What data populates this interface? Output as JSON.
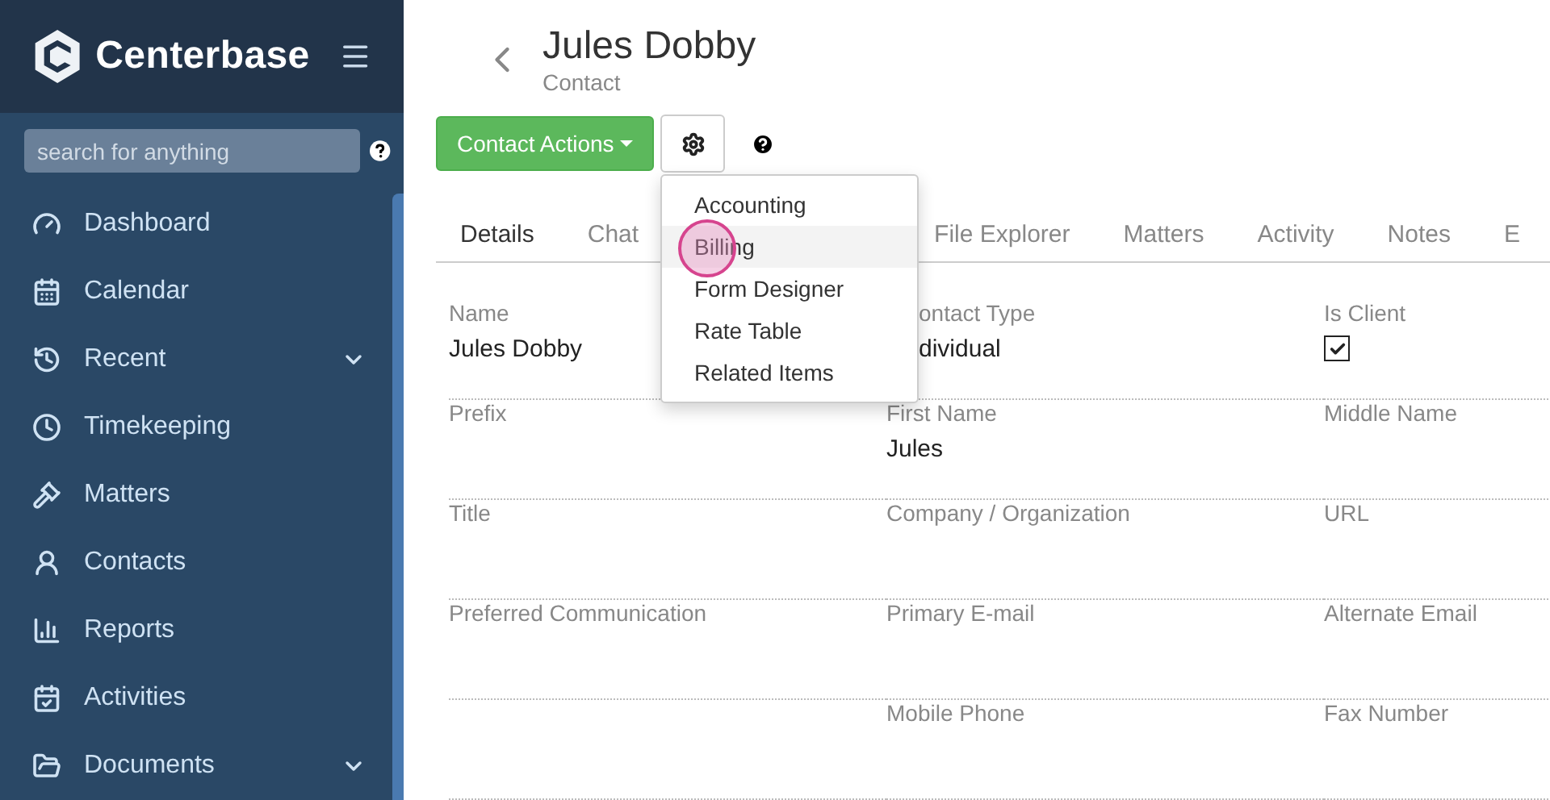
{
  "sidebar": {
    "brand": "Centerbase",
    "search": {
      "placeholder": "search for anything"
    },
    "items": [
      {
        "label": "Dashboard",
        "expandable": false
      },
      {
        "label": "Calendar",
        "expandable": false
      },
      {
        "label": "Recent",
        "expandable": true
      },
      {
        "label": "Timekeeping",
        "expandable": false
      },
      {
        "label": "Matters",
        "expandable": false
      },
      {
        "label": "Contacts",
        "expandable": false
      },
      {
        "label": "Reports",
        "expandable": false
      },
      {
        "label": "Activities",
        "expandable": false
      },
      {
        "label": "Documents",
        "expandable": true
      }
    ]
  },
  "header": {
    "title": "Jules Dobby",
    "subtitle": "Contact"
  },
  "toolbar": {
    "actions_button": "Contact Actions"
  },
  "tabs": [
    {
      "label": "Details",
      "selected": true
    },
    {
      "label": "Chat",
      "selected": false
    },
    {
      "label": "File Explorer",
      "selected": false
    },
    {
      "label": "Matters",
      "selected": false
    },
    {
      "label": "Activity",
      "selected": false
    },
    {
      "label": "Notes",
      "selected": false
    },
    {
      "label": "E",
      "selected": false
    }
  ],
  "fields": [
    {
      "kind": "text",
      "label": "Name",
      "value": "Jules Dobby"
    },
    {
      "kind": "covered",
      "label": "ontact Type",
      "value": "dividual"
    },
    {
      "kind": "checkbox",
      "label": "Is Client",
      "checked": true
    },
    {
      "kind": "text",
      "label": "Prefix"
    },
    {
      "kind": "text",
      "label": "First Name",
      "value": "Jules"
    },
    {
      "kind": "text",
      "label": "Middle Name"
    },
    {
      "kind": "text",
      "label": "Title"
    },
    {
      "kind": "text",
      "label": "Company / Organization"
    },
    {
      "kind": "text",
      "label": "URL"
    },
    {
      "kind": "text",
      "label": "Preferred Communication"
    },
    {
      "kind": "text",
      "label": "Primary E-mail"
    },
    {
      "kind": "text",
      "label": "Alternate Email"
    },
    {
      "kind": "empty"
    },
    {
      "kind": "text",
      "label": "Mobile Phone"
    },
    {
      "kind": "text",
      "label": "Fax Number"
    }
  ],
  "settings_menu": {
    "items": [
      {
        "label": "Accounting",
        "highlighted": false,
        "clicked": false
      },
      {
        "label": "Billing",
        "highlighted": true,
        "clicked": true
      },
      {
        "label": "Form Designer",
        "highlighted": false,
        "clicked": false
      },
      {
        "label": "Rate Table",
        "highlighted": false,
        "clicked": false
      },
      {
        "label": "Related Items",
        "highlighted": false,
        "clicked": false
      }
    ]
  }
}
